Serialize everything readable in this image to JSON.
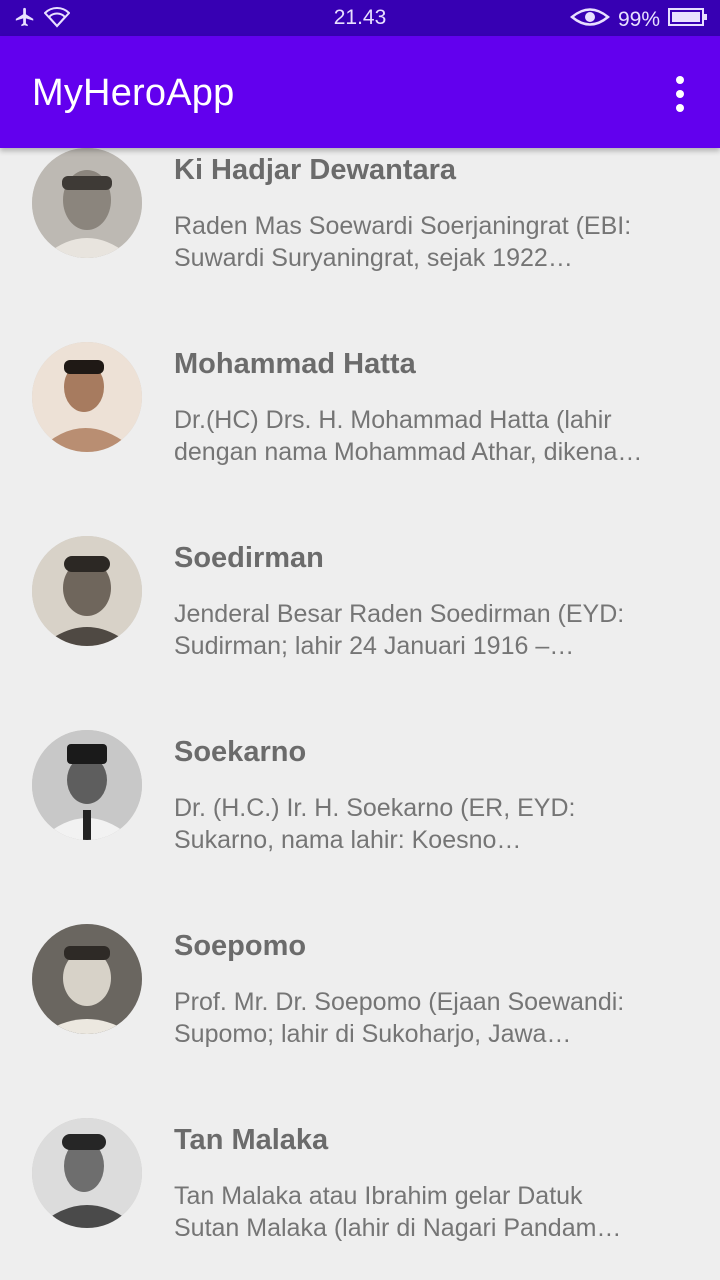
{
  "status_bar": {
    "time": "21.43",
    "battery": "99%",
    "icons": [
      "airplane-icon",
      "wifi-icon",
      "eye-icon",
      "battery-icon"
    ]
  },
  "app_bar": {
    "title": "MyHeroApp",
    "menu_icon": "overflow-menu-icon"
  },
  "colors": {
    "status_bar": "#3700b3",
    "app_bar": "#6200ee",
    "background": "#eeeeee",
    "name_text": "#6b6b6b",
    "desc_text": "#757575"
  },
  "heroes": [
    {
      "name": "Ki Hadjar Dewantara",
      "desc_line1": "Raden Mas Soewardi Soerjaningrat (EBI:",
      "desc_line2": "Suwardi Suryaningrat, sejak 1922…"
    },
    {
      "name": "Mohammad Hatta",
      "desc_line1": "Dr.(HC) Drs. H. Mohammad Hatta (lahir",
      "desc_line2": "dengan nama Mohammad Athar, dikena…"
    },
    {
      "name": "Soedirman",
      "desc_line1": "Jenderal Besar Raden Soedirman (EYD:",
      "desc_line2": "Sudirman; lahir 24 Januari 1916 –…"
    },
    {
      "name": "Soekarno",
      "desc_line1": "Dr. (H.C.) Ir. H. Soekarno (ER, EYD:",
      "desc_line2": "Sukarno, nama lahir: Koesno…"
    },
    {
      "name": "Soepomo",
      "desc_line1": "Prof. Mr. Dr. Soepomo (Ejaan Soewandi:",
      "desc_line2": "Supomo; lahir di Sukoharjo, Jawa…"
    },
    {
      "name": "Tan Malaka",
      "desc_line1": "Tan Malaka atau Ibrahim gelar Datuk",
      "desc_line2": "Sutan Malaka (lahir di Nagari Pandam…"
    }
  ]
}
